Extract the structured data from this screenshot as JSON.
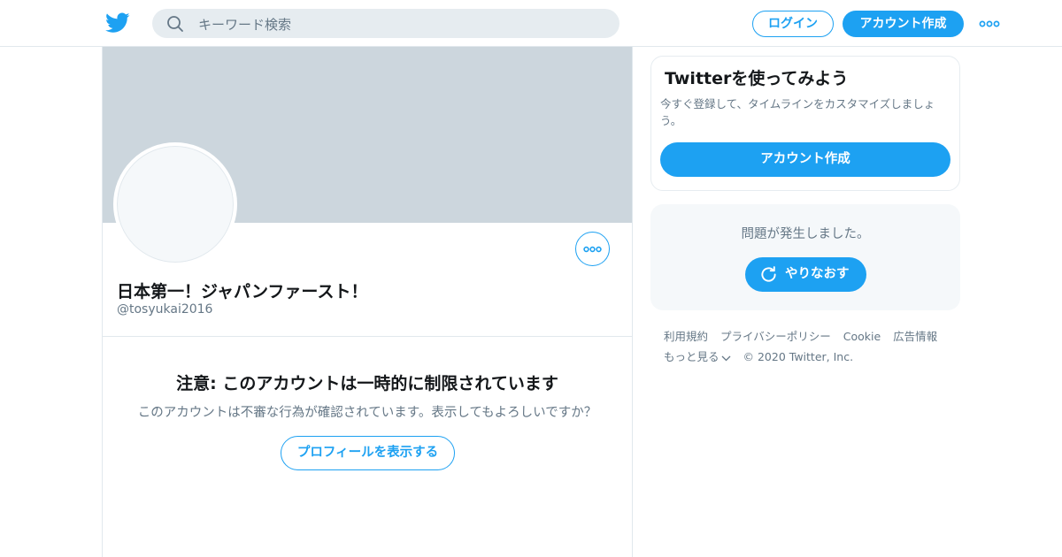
{
  "header": {
    "search_placeholder": "キーワード検索",
    "login_label": "ログイン",
    "signup_label": "アカウント作成"
  },
  "profile": {
    "display_name": "日本第一！ジャパンファースト！",
    "handle": "@tosyukai2016"
  },
  "warning": {
    "title": "注意: このアカウントは一時的に制限されています",
    "text": "このアカウントは不審な行為が確認されています。表示してもよろしいですか？",
    "view_button_label": "プロフィールを表示する"
  },
  "signup_card": {
    "title": "Twitterを使ってみよう",
    "text": "今すぐ登録して、タイムラインをカスタマイズしましょう。",
    "button_label": "アカウント作成"
  },
  "error_card": {
    "message": "問題が発生しました。",
    "retry_label": "やりなおす"
  },
  "footer": {
    "links": [
      "利用規約",
      "プライバシーポリシー",
      "Cookie",
      "広告情報",
      "もっと見る"
    ],
    "copyright": "© 2020 Twitter, Inc."
  },
  "colors": {
    "accent": "#1da1f2",
    "banner": "#ccd6dd",
    "muted_text": "#657786",
    "border": "#e1e8ed"
  },
  "icons": [
    "twitter-logo-icon",
    "search-icon",
    "more-horizontal-icon",
    "refresh-icon",
    "chevron-down-icon"
  ]
}
